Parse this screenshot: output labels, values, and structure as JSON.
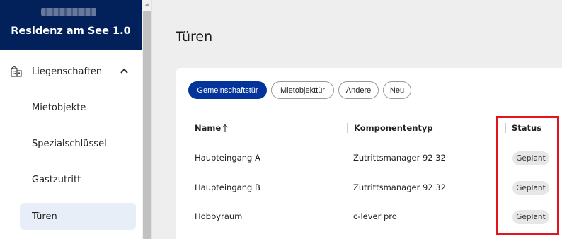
{
  "app": {
    "subtitle": "",
    "title": "Residenz am See 1.0"
  },
  "sidebar": {
    "parent": {
      "label": "Liegenschaften",
      "icon": "building-icon",
      "expanded": true
    },
    "items": [
      {
        "label": "Mietobjekte",
        "active": false
      },
      {
        "label": "Spezialschlüssel",
        "active": false
      },
      {
        "label": "Gastzutritt",
        "active": false
      },
      {
        "label": "Türen",
        "active": true
      }
    ]
  },
  "page": {
    "title": "Türen"
  },
  "filters": [
    {
      "label": "Gemeinschaftstür",
      "active": true
    },
    {
      "label": "Mietobjekttür",
      "active": false
    },
    {
      "label": "Andere",
      "active": false
    },
    {
      "label": "Neu",
      "active": false
    }
  ],
  "table": {
    "columns": [
      {
        "label": "Name",
        "sort": "ascending"
      },
      {
        "label": "Komponententyp"
      },
      {
        "label": "Status"
      }
    ],
    "rows": [
      {
        "name": "Haupteingang A",
        "type": "Zutrittsmanager 92 32",
        "status": "Geplant"
      },
      {
        "name": "Haupteingang B",
        "type": "Zutrittsmanager 92 32",
        "status": "Geplant"
      },
      {
        "name": "Hobbyraum",
        "type": "c-lever pro",
        "status": "Geplant"
      }
    ]
  },
  "colors": {
    "brand": "#02205a",
    "accent": "#02349c",
    "highlight": "#e3141b"
  }
}
